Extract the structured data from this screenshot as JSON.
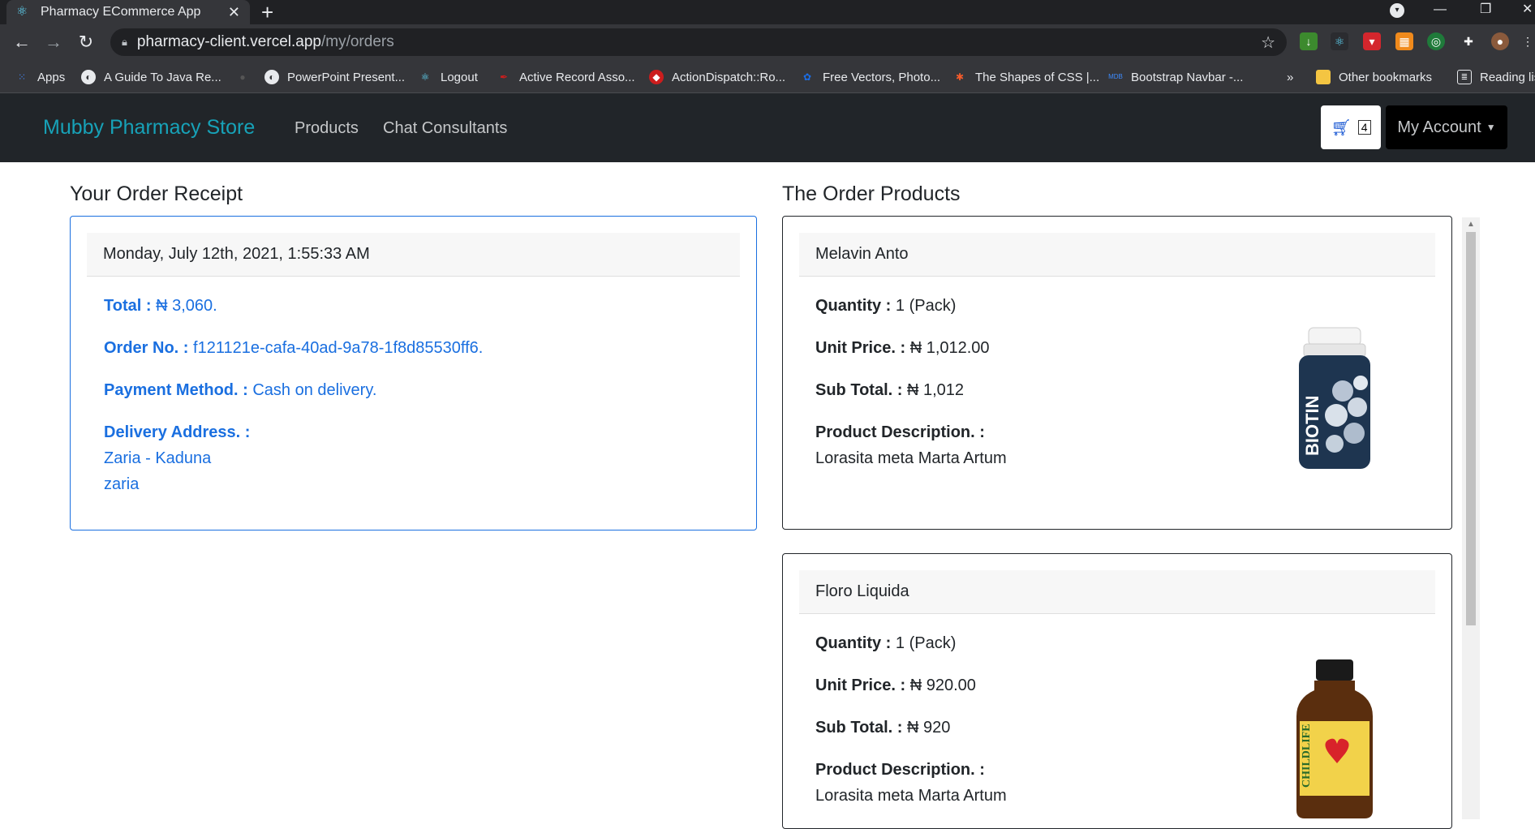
{
  "browser": {
    "tab_title": "Pharmacy ECommerce App",
    "url_host": "pharmacy-client.vercel.app",
    "url_path": "/my/orders",
    "bookmarks": [
      {
        "label": "Apps"
      },
      {
        "label": "A Guide To Java Re..."
      },
      {
        "label": "PowerPoint Present..."
      },
      {
        "label": "Logout"
      },
      {
        "label": "Active Record Asso..."
      },
      {
        "label": "ActionDispatch::Ro..."
      },
      {
        "label": "Free Vectors, Photo..."
      },
      {
        "label": "The Shapes of CSS |..."
      },
      {
        "label": "Bootstrap Navbar -..."
      }
    ],
    "bookmarks_overflow": "»",
    "other_bookmarks": "Other bookmarks",
    "reading_list": "Reading list"
  },
  "navbar": {
    "brand": "Mubby Pharmacy Store",
    "links": [
      "Products",
      "Chat Consultants"
    ],
    "cart_count": "4",
    "account_label": "My Account"
  },
  "receipt": {
    "heading": "Your Order Receipt",
    "date": "Monday, July 12th, 2021, 1:55:33 AM",
    "total_label": "Total :",
    "total_value": "₦ 3,060.",
    "order_no_label": "Order No. :",
    "order_no_value": "f121121e-cafa-40ad-9a78-1f8d85530ff6.",
    "payment_label": "Payment Method. :",
    "payment_value": "Cash on delivery.",
    "address_label": "Delivery Address. :",
    "address_line1": "Zaria - Kaduna",
    "address_line2": "zaria"
  },
  "products": {
    "heading": "The Order Products",
    "quantity_label": "Quantity :",
    "unit_price_label": "Unit Price. :",
    "sub_total_label": "Sub Total. :",
    "description_label": "Product Description. :",
    "items": [
      {
        "name": "Melavin Anto",
        "quantity": "1 (Pack)",
        "unit_price": "₦ 1,012.00",
        "sub_total": "₦ 1,012",
        "description": "Lorasita meta Marta Artum",
        "image_label": "BIOTIN"
      },
      {
        "name": "Floro Liquida",
        "quantity": "1 (Pack)",
        "unit_price": "₦ 920.00",
        "sub_total": "₦ 920",
        "description": "Lorasita meta Marta Artum",
        "image_label": "CHILDLIFE"
      }
    ]
  },
  "colors": {
    "brand": "#17a2b8",
    "navbar_bg": "#212529",
    "receipt_accent": "#1a6fe0",
    "cart_icon": "#0d4fd1"
  }
}
